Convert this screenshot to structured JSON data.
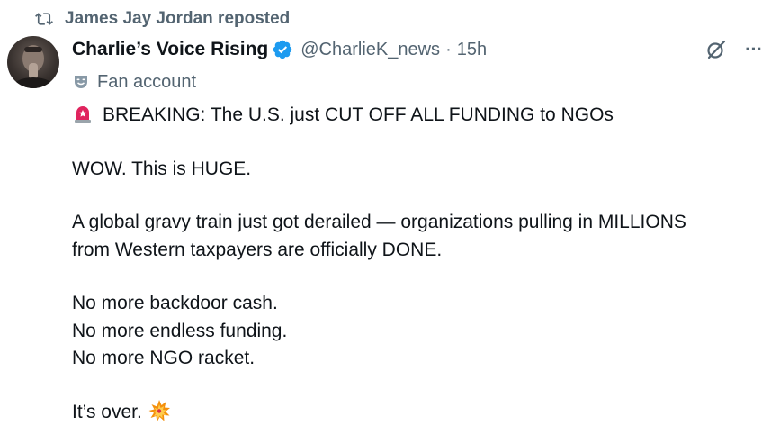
{
  "repost": {
    "icon": "repost-icon",
    "text": "James Jay Jordan reposted"
  },
  "author": {
    "display_name": "Charlie’s Voice Rising",
    "verified_icon": "verified-badge-icon",
    "handle": "@CharlieK_news",
    "separator": "·",
    "time": "15h",
    "avatar_icon": "avatar",
    "label_icon": "theater-mask-icon",
    "label": "Fan account"
  },
  "actions": {
    "grok_icon": "grok-icon",
    "more_icon": "more-options-icon",
    "more_glyph": "···"
  },
  "post": {
    "line1_icon": "siren-icon",
    "line1": "BREAKING: The U.S. just CUT OFF ALL FUNDING to NGOs",
    "line2": "WOW. This is HUGE.",
    "line3": "A global gravy train just got derailed — organizations pulling in MILLIONS",
    "line4": "from Western taxpayers are officially DONE.",
    "line5": "No more backdoor cash.",
    "line6": "No more endless funding.",
    "line7": "No more NGO racket.",
    "line8": "It’s over.",
    "line8_icon": "collision-icon"
  },
  "colors": {
    "text": "#0f1419",
    "secondary": "#536471",
    "verified": "#1d9bf0",
    "siren": "#e0245e"
  }
}
